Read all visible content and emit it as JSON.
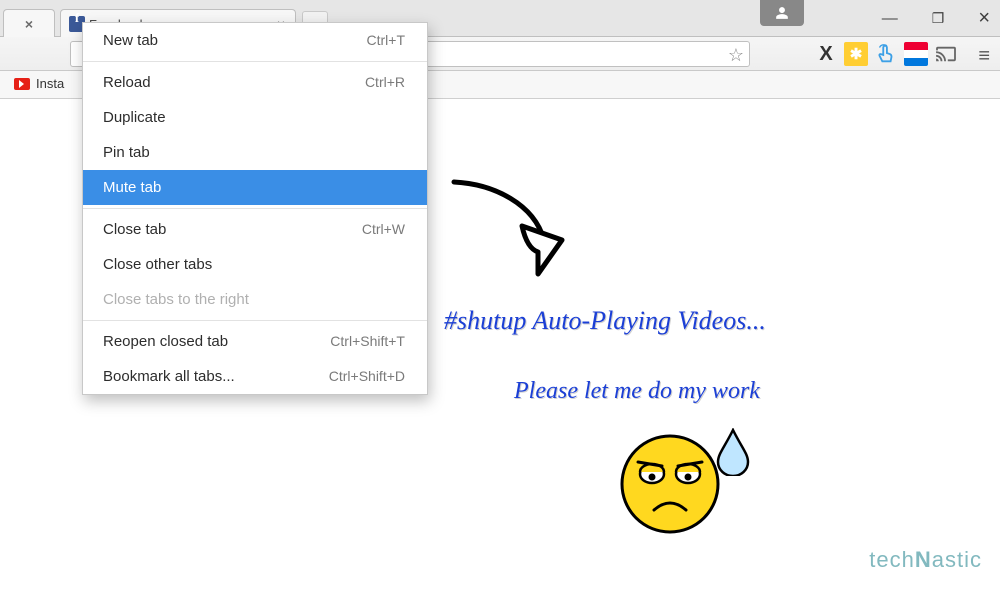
{
  "tabs": {
    "main_title": "Facebook"
  },
  "bookmarks": {
    "item1": "Insta"
  },
  "contextMenu": {
    "items": [
      {
        "label": "New tab",
        "shortcut": "Ctrl+T"
      },
      {
        "label": "Reload",
        "shortcut": "Ctrl+R"
      },
      {
        "label": "Duplicate",
        "shortcut": ""
      },
      {
        "label": "Pin tab",
        "shortcut": ""
      },
      {
        "label": "Mute tab",
        "shortcut": ""
      },
      {
        "label": "Close tab",
        "shortcut": "Ctrl+W"
      },
      {
        "label": "Close other tabs",
        "shortcut": ""
      },
      {
        "label": "Close tabs to the right",
        "shortcut": ""
      },
      {
        "label": "Reopen closed tab",
        "shortcut": "Ctrl+Shift+T"
      },
      {
        "label": "Bookmark all tabs...",
        "shortcut": "Ctrl+Shift+D"
      }
    ]
  },
  "annotations": {
    "line1": "#shutup Auto-Playing Videos...",
    "line2": "Please let me do my work"
  },
  "watermark": "techNastic"
}
